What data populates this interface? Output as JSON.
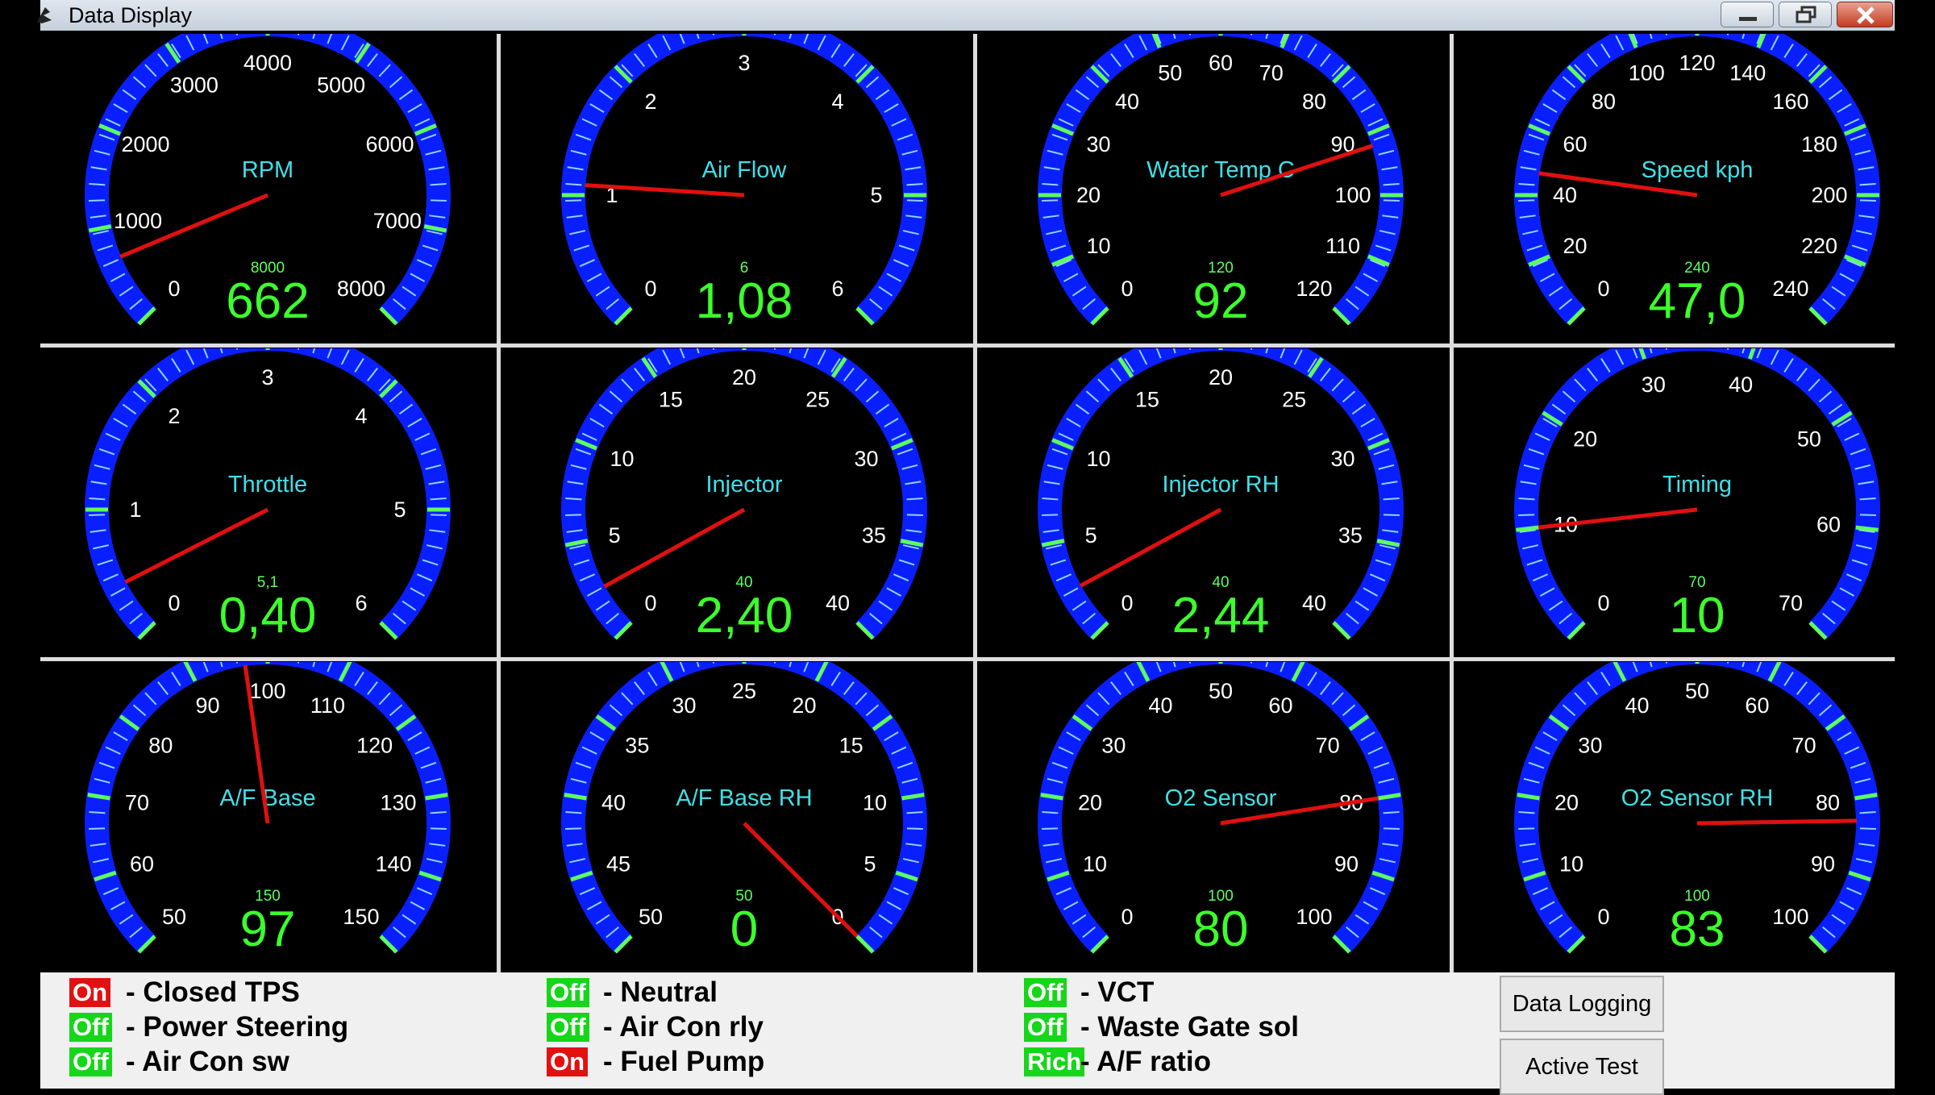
{
  "window": {
    "title": "Data Display"
  },
  "gauges": [
    {
      "label": "RPM",
      "ticks": [
        "0",
        "1000",
        "2000",
        "3000",
        "4000",
        "5000",
        "6000",
        "7000",
        "8000"
      ],
      "max_label": "8000",
      "value": "662",
      "min": 0,
      "max": 8000,
      "reading": 662
    },
    {
      "label": "Air Flow",
      "ticks": [
        "0",
        "1",
        "2",
        "3",
        "4",
        "5",
        "6"
      ],
      "max_label": "6",
      "value": "1,08",
      "min": 0,
      "max": 6,
      "reading": 1.08
    },
    {
      "label": "Water Temp C",
      "ticks": [
        "0",
        "10",
        "20",
        "30",
        "40",
        "50",
        "60",
        "70",
        "80",
        "90",
        "100",
        "110",
        "120"
      ],
      "max_label": "120",
      "value": "92",
      "min": 0,
      "max": 120,
      "reading": 92
    },
    {
      "label": "Speed kph",
      "ticks": [
        "0",
        "20",
        "40",
        "60",
        "80",
        "100",
        "120",
        "140",
        "160",
        "180",
        "200",
        "220",
        "240"
      ],
      "max_label": "240",
      "value": "47,0",
      "min": 0,
      "max": 240,
      "reading": 47
    },
    {
      "label": "Throttle",
      "ticks": [
        "0",
        "1",
        "2",
        "3",
        "4",
        "5",
        "6"
      ],
      "max_label": "5,1",
      "value": "0,40",
      "min": 0,
      "max": 6,
      "reading": 0.4
    },
    {
      "label": "Injector",
      "ticks": [
        "0",
        "5",
        "10",
        "15",
        "20",
        "25",
        "30",
        "35",
        "40"
      ],
      "max_label": "40",
      "value": "2,40",
      "min": 0,
      "max": 40,
      "reading": 2.4
    },
    {
      "label": "Injector RH",
      "ticks": [
        "0",
        "5",
        "10",
        "15",
        "20",
        "25",
        "30",
        "35",
        "40"
      ],
      "max_label": "40",
      "value": "2,44",
      "min": 0,
      "max": 40,
      "reading": 2.44
    },
    {
      "label": "Timing",
      "ticks": [
        "0",
        "10",
        "20",
        "30",
        "40",
        "50",
        "60",
        "70"
      ],
      "max_label": "70",
      "value": "10",
      "min": 0,
      "max": 70,
      "reading": 10
    },
    {
      "label": "A/F Base",
      "ticks": [
        "50",
        "60",
        "70",
        "80",
        "90",
        "100",
        "110",
        "120",
        "130",
        "140",
        "150"
      ],
      "max_label": "150",
      "value": "97",
      "min": 50,
      "max": 150,
      "reading": 97
    },
    {
      "label": "A/F Base RH",
      "ticks": [
        "50",
        "45",
        "40",
        "35",
        "30",
        "25",
        "20",
        "15",
        "10",
        "5",
        "0"
      ],
      "max_label": "50",
      "value": "0",
      "min": 50,
      "max": 0,
      "reading": 0
    },
    {
      "label": "O2 Sensor",
      "ticks": [
        "0",
        "10",
        "20",
        "30",
        "40",
        "50",
        "60",
        "70",
        "80",
        "90",
        "100"
      ],
      "max_label": "100",
      "value": "80",
      "min": 0,
      "max": 100,
      "reading": 80
    },
    {
      "label": "O2 Sensor RH",
      "ticks": [
        "0",
        "10",
        "20",
        "30",
        "40",
        "50",
        "60",
        "70",
        "80",
        "90",
        "100"
      ],
      "max_label": "100",
      "value": "83",
      "min": 0,
      "max": 100,
      "reading": 83
    }
  ],
  "status": {
    "columns": [
      [
        {
          "state": "On",
          "kind": "on",
          "label": "- Closed TPS"
        },
        {
          "state": "Off",
          "kind": "off",
          "label": "- Power Steering"
        },
        {
          "state": "Off",
          "kind": "off",
          "label": "- Air Con sw"
        }
      ],
      [
        {
          "state": "Off",
          "kind": "off",
          "label": "- Neutral"
        },
        {
          "state": "Off",
          "kind": "off",
          "label": "- Air Con rly"
        },
        {
          "state": "On",
          "kind": "on",
          "label": "- Fuel Pump"
        }
      ],
      [
        {
          "state": "Off",
          "kind": "off",
          "label": "- VCT"
        },
        {
          "state": "Off",
          "kind": "off",
          "label": "- Waste Gate sol"
        },
        {
          "state": "Rich",
          "kind": "rich",
          "label": "- A/F ratio"
        }
      ]
    ],
    "buttons": {
      "data_logging": "Data Logging",
      "active_test": "Active Test"
    }
  },
  "colors": {
    "dial": "#0a1fff",
    "tick": "#5cff5c",
    "needle": "#e01010",
    "label": "#40e0e8",
    "readout": "#3cff2c"
  }
}
